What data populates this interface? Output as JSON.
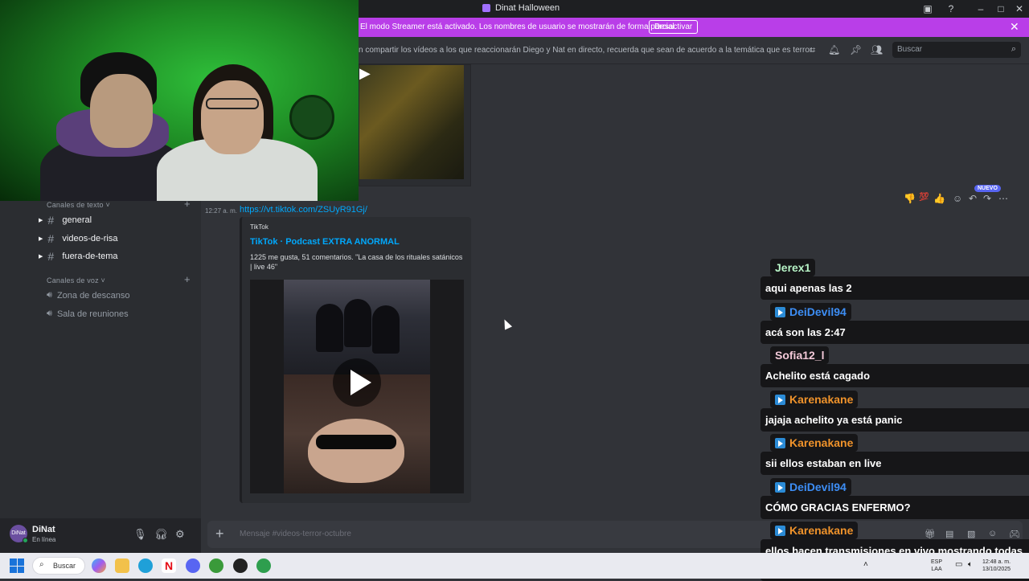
{
  "window": {
    "title": "Dinat Halloween"
  },
  "banner": {
    "text": "El modo Streamer está activado. Los nombres de usuario se mostrarán de forma parcial.",
    "button": "Desactivar"
  },
  "header": {
    "topic": "n compartir los vídeos a los que reaccionarán Diego y Nat en directo, recuerda que sean de acuerdo a la temática que es terror.",
    "search_placeholder": "Buscar"
  },
  "sidebar": {
    "text_category": "Canales de texto",
    "text_channels": [
      "general",
      "videos-de-risa",
      "fuera-de-tema"
    ],
    "voice_category": "Canales de voz",
    "voice_channels": [
      "Zona de descanso",
      "Sala de reuniones"
    ]
  },
  "user": {
    "name": "DiNat",
    "status": "En línea",
    "avatar_text": "DiNat"
  },
  "message": {
    "time": "12:27 a. m.",
    "link": "https://vt.tiktok.com/ZSUyR91Gj/",
    "embed": {
      "provider": "TikTok",
      "title": "TikTok · Podcast EXTRA ANORMAL",
      "description": "1225 me gusta, 51 comentarios. \"La casa de los rituales satánicos | live 46\""
    }
  },
  "new_badge": "NUEVO",
  "composer": {
    "placeholder": "Mensaje #videos-terror-octubre"
  },
  "stream_chat": [
    {
      "user": "Jerex1",
      "color": "#b7f3c6",
      "badge": false,
      "text": "aqui apenas las 2"
    },
    {
      "user": "DeiDevil94",
      "color": "#3d8ef5",
      "badge": true,
      "text": "acá son las 2:47"
    },
    {
      "user": "Sofia12_l",
      "color": "#f3c9d8",
      "badge": false,
      "text": "Achelito está cagado"
    },
    {
      "user": "Karenakane",
      "color": "#f0932b",
      "badge": true,
      "text": "jajaja achelito ya está panic"
    },
    {
      "user": "Karenakane",
      "color": "#f0932b",
      "badge": true,
      "text": "sii ellos estaban en live"
    },
    {
      "user": "DeiDevil94",
      "color": "#3d8ef5",
      "badge": true,
      "text": "CÓMO GRACIAS ENFERMO?"
    },
    {
      "user": "Karenakane",
      "color": "#f0932b",
      "badge": true,
      "text": "ellos hacen transmisiones en vivo mostrando todas esas cosas"
    }
  ],
  "taskbar": {
    "search": "Buscar",
    "lang_top": "ESP",
    "lang_bottom": "LAA",
    "time": "12:48 a. m.",
    "date": "13/10/2025"
  },
  "icons": {
    "accent": "#b93ee8",
    "link_color": "#00a8fc",
    "online": "#23a55a"
  }
}
